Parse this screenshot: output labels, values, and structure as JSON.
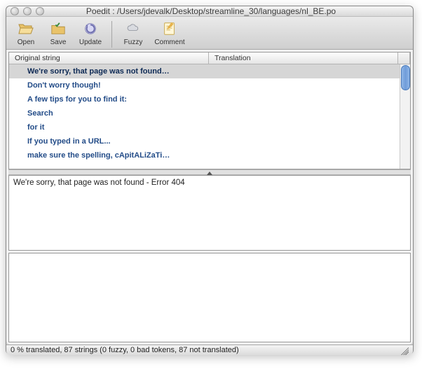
{
  "titlebar": {
    "app": "Poedit",
    "title": "Poedit : /Users/jdevalk/Desktop/streamline_30/languages/nl_BE.po"
  },
  "toolbar": {
    "open": "Open",
    "save": "Save",
    "update": "Update",
    "fuzzy": "Fuzzy",
    "comment": "Comment"
  },
  "columns": {
    "original": "Original string",
    "translation": "Translation"
  },
  "rows": [
    {
      "orig": "We're sorry, that page was not found…",
      "trans": "",
      "selected": true
    },
    {
      "orig": "Don't worry though!",
      "trans": ""
    },
    {
      "orig": "A few tips for you to find it:",
      "trans": ""
    },
    {
      "orig": "Search",
      "trans": ""
    },
    {
      "orig": "for it",
      "trans": ""
    },
    {
      "orig": "If you typed in a URL...",
      "trans": ""
    },
    {
      "orig": "make sure the spelling, cApitALiZaTi…",
      "trans": ""
    }
  ],
  "source_text": "We're sorry, that page was not found - Error 404",
  "translation_text": "",
  "status": "0 % translated, 87 strings (0 fuzzy, 0 bad tokens, 87 not translated)"
}
